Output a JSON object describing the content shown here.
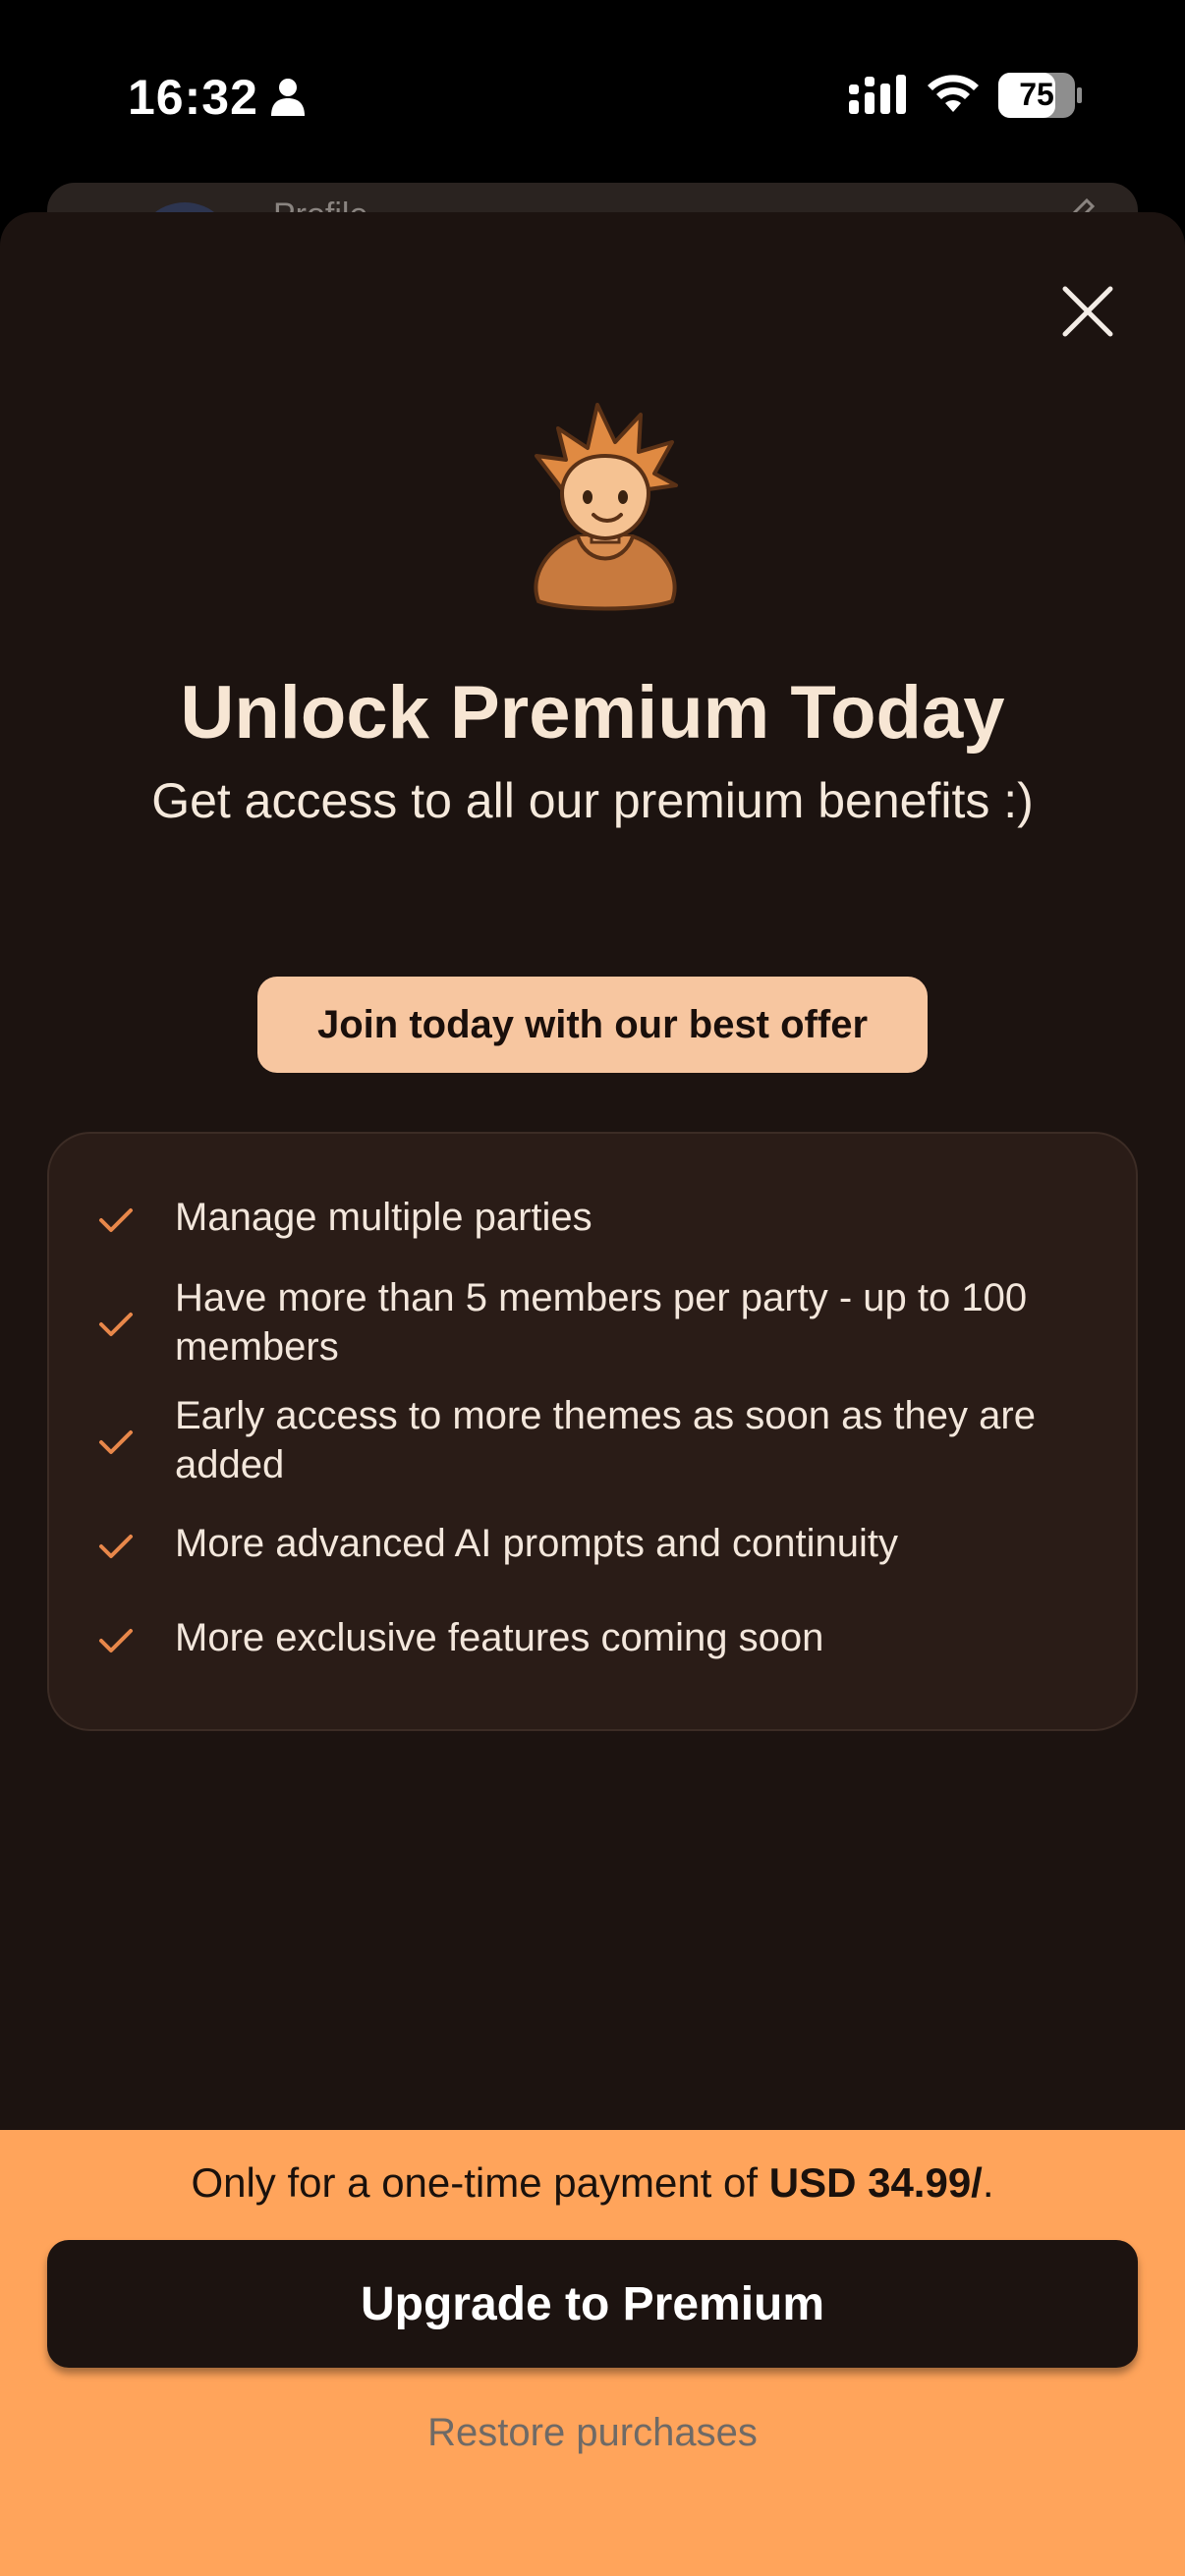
{
  "status_bar": {
    "time": "16:32",
    "battery": "75",
    "icons": [
      "person-icon",
      "signal-icon",
      "wifi-icon",
      "battery-icon"
    ]
  },
  "background": {
    "card_label": "Profile"
  },
  "modal": {
    "title": "Unlock Premium Today",
    "subtitle": "Get access to all our premium benefits :)",
    "offer_label": "Join today with our best offer",
    "benefits": [
      "Manage multiple parties",
      "Have more than 5 members per party - up to 100 members",
      "Early access to more themes as soon as they are added",
      "More advanced AI prompts and continuity",
      "More exclusive features coming soon"
    ]
  },
  "cta": {
    "price_prefix": "Only for a one-time payment of ",
    "price": "USD 34.99/",
    "price_suffix": ".",
    "upgrade_label": "Upgrade to Premium",
    "restore_label": "Restore purchases"
  },
  "colors": {
    "sheet_background": "#1c1310",
    "accent_orange": "#ffa45b",
    "offer_pill": "#f7c6a0",
    "check_color": "#e8874a",
    "title_color": "#f7e6d4"
  }
}
